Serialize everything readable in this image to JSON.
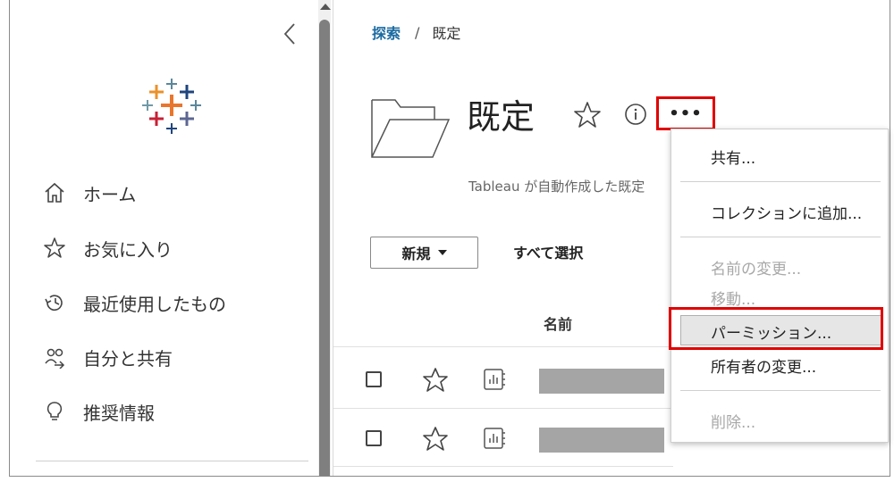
{
  "sidebar": {
    "collapse_label": "<",
    "items": [
      {
        "label": "ホーム",
        "icon": "home-icon"
      },
      {
        "label": "お気に入り",
        "icon": "star-icon"
      },
      {
        "label": "最近使用したもの",
        "icon": "history-icon"
      },
      {
        "label": "自分と共有",
        "icon": "shared-users-icon"
      },
      {
        "label": "推奨情報",
        "icon": "lightbulb-icon"
      }
    ]
  },
  "breadcrumb": {
    "root": "探索",
    "separator": "/",
    "current": "既定"
  },
  "project": {
    "title": "既定",
    "description": "Tableau が自動作成した既定"
  },
  "toolbar": {
    "new_label": "新規",
    "select_all_label": "すべて選択",
    "more_label": "•••"
  },
  "table": {
    "name_header": "名前",
    "rows": [
      {
        "icon": "workbook-icon"
      },
      {
        "icon": "workbook-icon"
      }
    ]
  },
  "menu": {
    "share": "共有...",
    "add_to_collection": "コレクションに追加...",
    "rename": "名前の変更...",
    "move": "移動...",
    "permissions": "パーミッション...",
    "change_owner": "所有者の変更...",
    "delete": "削除..."
  },
  "colors": {
    "accent_link": "#1a6aa0",
    "highlight_red": "#e00000",
    "disabled_text": "#a8a8a8"
  }
}
